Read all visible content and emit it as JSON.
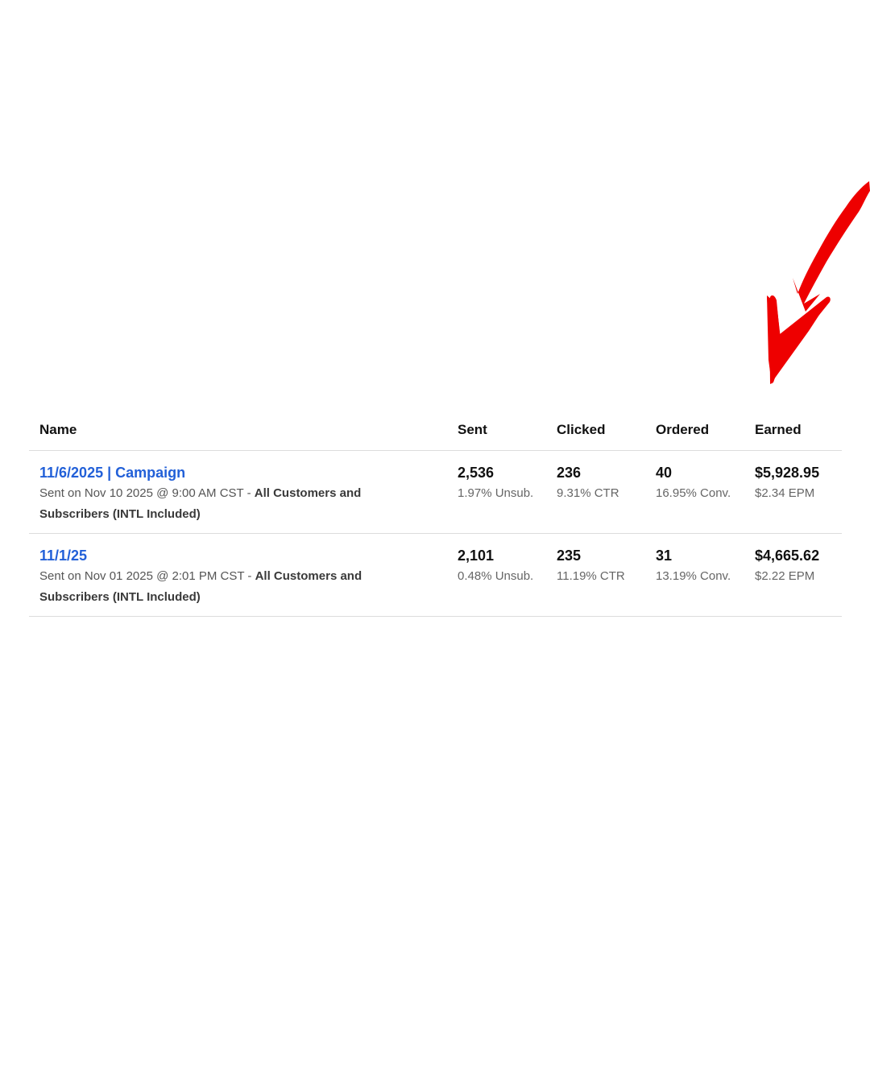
{
  "colors": {
    "link": "#2260d8",
    "arrow": "#ee0000",
    "divider": "#dcdcdc"
  },
  "annotation": {
    "icon": "red-arrow-icon"
  },
  "table": {
    "headers": {
      "name": "Name",
      "sent": "Sent",
      "clicked": "Clicked",
      "ordered": "Ordered",
      "earned": "Earned"
    },
    "rows": [
      {
        "name": "11/6/2025 | Campaign",
        "sent_prefix": "Sent on Nov 10 2025 @ 9:00 AM CST - ",
        "audience": "All Customers and Subscribers (INTL Included)",
        "sent": "2,536",
        "unsub": "1.97% Unsub.",
        "clicked": "236",
        "ctr": "9.31% CTR",
        "ordered": "40",
        "conv": "16.95% Conv.",
        "earned": "$5,928.95",
        "epm": "$2.34 EPM"
      },
      {
        "name": "11/1/25",
        "sent_prefix": "Sent on Nov 01 2025 @ 2:01 PM CST - ",
        "audience": "All Customers and Subscribers (INTL Included)",
        "sent": "2,101",
        "unsub": "0.48% Unsub.",
        "clicked": "235",
        "ctr": "11.19% CTR",
        "ordered": "31",
        "conv": "13.19% Conv.",
        "earned": "$4,665.62",
        "epm": "$2.22 EPM"
      }
    ]
  }
}
